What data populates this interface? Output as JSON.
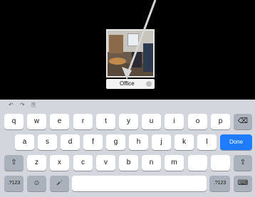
{
  "photo": {
    "name_value": "Office"
  },
  "keyboard": {
    "toolbar": {
      "undo": "↶",
      "redo": "↷",
      "paste": "⎘"
    },
    "row1": [
      "q",
      "w",
      "e",
      "r",
      "t",
      "y",
      "u",
      "i",
      "o",
      "p"
    ],
    "backspace": "⌫",
    "row2": [
      "a",
      "s",
      "d",
      "f",
      "g",
      "h",
      "j",
      "k",
      "l"
    ],
    "done_label": "Done",
    "shift": "⇧",
    "row3": [
      "z",
      "x",
      "c",
      "v",
      "b",
      "n",
      "m"
    ],
    "punct1": "!\n,",
    "punct2": "?\n.",
    "numbers_label": ".?123",
    "emoji": "☺",
    "mic": "🎤",
    "hide_keyboard": "⌨"
  }
}
